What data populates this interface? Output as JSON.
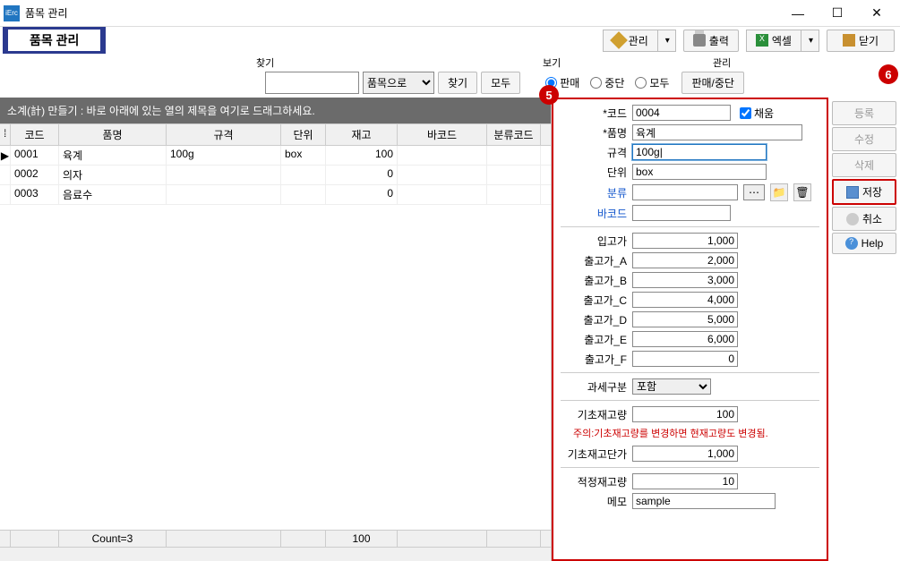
{
  "window": {
    "app_icon_text": "iErc",
    "title": "품목 관리"
  },
  "page_title": "품목 관리",
  "toolbar": {
    "manage": "관리",
    "print": "출력",
    "excel": "엑셀",
    "close": "닫기"
  },
  "sections": {
    "search": "찾기",
    "view": "보기",
    "manage": "관리"
  },
  "search": {
    "input": "",
    "mode": "품목으로",
    "find": "찾기",
    "all": "모두"
  },
  "view": {
    "sale": "판매",
    "stopped": "중단",
    "all": "모두",
    "selected": "sale"
  },
  "manage_btn": "판매/중단",
  "side": {
    "register": "등록",
    "edit": "수정",
    "delete": "삭제",
    "save": "저장",
    "cancel": "취소",
    "help": "Help"
  },
  "grid": {
    "group_hint": "소계(計) 만들기 : 바로 아래에 있는 열의 제목을 여기로 드래그하세요.",
    "columns": {
      "code": "코드",
      "name": "품명",
      "spec": "규격",
      "unit": "단위",
      "stock": "재고",
      "barcode": "바코드",
      "cat": "분류코드"
    },
    "rows": [
      {
        "marker": "▶",
        "code": "0001",
        "name": "육계",
        "spec": "100g",
        "unit": "box",
        "stock": "100",
        "barcode": "",
        "cat": ""
      },
      {
        "marker": "",
        "code": "0002",
        "name": "의자",
        "spec": "",
        "unit": "",
        "stock": "0",
        "barcode": "",
        "cat": ""
      },
      {
        "marker": "",
        "code": "0003",
        "name": "음료수",
        "spec": "",
        "unit": "",
        "stock": "0",
        "barcode": "",
        "cat": ""
      }
    ],
    "footer": {
      "count": "Count=3",
      "stock_sum": "100"
    }
  },
  "detail": {
    "labels": {
      "code": "*코드",
      "name": "*품명",
      "spec": "규격",
      "unit": "단위",
      "cat": "분류",
      "barcode": "바코드",
      "inprice": "입고가",
      "out_a": "출고가_A",
      "out_b": "출고가_B",
      "out_c": "출고가_C",
      "out_d": "출고가_D",
      "out_e": "출고가_E",
      "out_f": "출고가_F",
      "tax": "과세구분",
      "init_stock": "기초재고량",
      "init_unit": "기초재고단가",
      "proper_stock": "적정재고량",
      "memo": "메모"
    },
    "autofill_label": "채움",
    "values": {
      "code": "0004",
      "name": "육계",
      "spec": "100g|",
      "unit": "box",
      "cat": "",
      "barcode": "",
      "inprice": "1,000",
      "out_a": "2,000",
      "out_b": "3,000",
      "out_c": "4,000",
      "out_d": "5,000",
      "out_e": "6,000",
      "out_f": "0",
      "tax": "포함",
      "init_stock": "100",
      "init_unit": "1,000",
      "proper_stock": "10",
      "memo": "sample"
    },
    "warning": "주의:기초재고량를 변경하면 현재고량도 변경됨."
  },
  "callouts": {
    "c5": "5",
    "c6": "6"
  }
}
